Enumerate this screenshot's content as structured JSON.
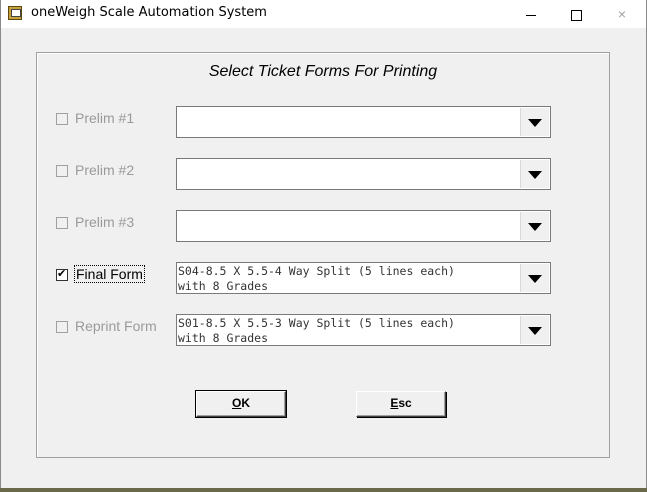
{
  "window": {
    "title": "oneWeigh Scale Automation System",
    "controls": {
      "minimize": "minimize",
      "maximize": "maximize",
      "close": "×"
    }
  },
  "dialog": {
    "heading": "Select Ticket Forms For Printing",
    "rows": [
      {
        "label": "Prelim #1",
        "checked": false,
        "enabled": false,
        "value": ""
      },
      {
        "label": "Prelim #2",
        "checked": false,
        "enabled": false,
        "value": ""
      },
      {
        "label": "Prelim #3",
        "checked": false,
        "enabled": false,
        "value": ""
      },
      {
        "label": "Final Form",
        "checked": true,
        "enabled": true,
        "value": "S04-8.5 X 5.5-4 Way Split (5 lines each)\nwith 8 Grades"
      },
      {
        "label": "Reprint Form",
        "checked": false,
        "enabled": false,
        "value": "S01-8.5 X 5.5-3 Way Split (5 lines each)\nwith 8 Grades"
      }
    ],
    "buttons": {
      "ok_underline": "O",
      "ok_rest": "K",
      "esc_underline": "E",
      "esc_rest": "sc"
    }
  },
  "colors": {
    "disabled_text": "#9a9a9a",
    "background": "#f0f0f0"
  }
}
